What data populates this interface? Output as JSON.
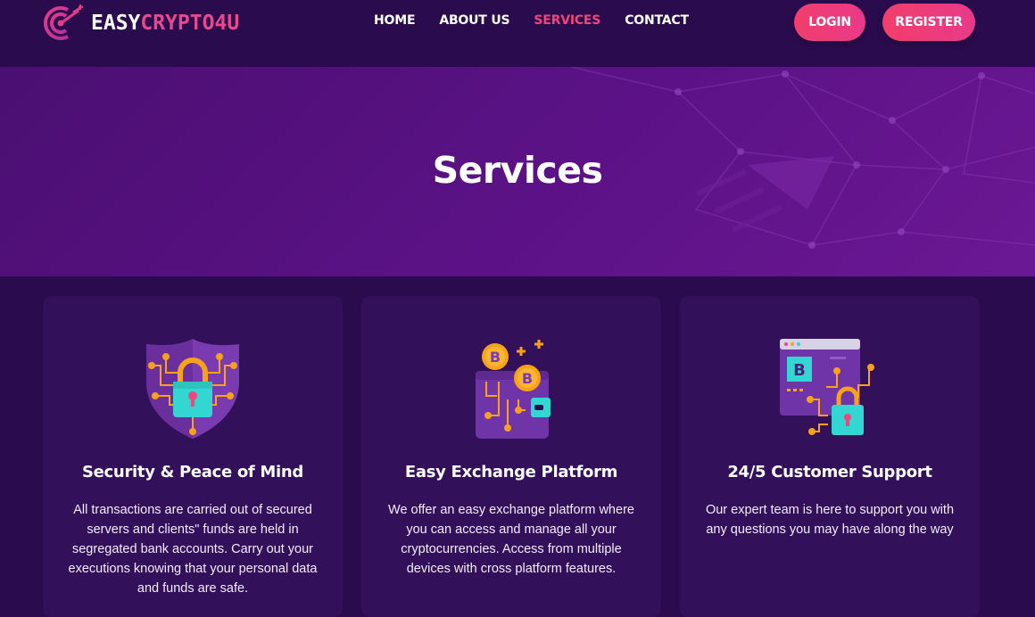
{
  "logo": {
    "text_white": "EASY",
    "text_pink": "CRYPTO4U"
  },
  "nav": {
    "items": [
      {
        "label": "HOME"
      },
      {
        "label": "ABOUT US"
      },
      {
        "label": "SERVICES"
      },
      {
        "label": "CONTACT"
      }
    ],
    "active": "SERVICES"
  },
  "auth": {
    "login_label": "LOGIN",
    "register_label": "REGISTER"
  },
  "hero": {
    "title": "Services"
  },
  "services": [
    {
      "icon": "shield-lock-icon",
      "title": "Security & Peace of Mind",
      "text": "All transactions are carried out of secured servers and clients\" funds are held in segregated bank accounts. Carry out your executions knowing that your personal data and funds are safe."
    },
    {
      "icon": "bitcoin-wallet-icon",
      "title": "Easy Exchange Platform",
      "text": "We offer an easy exchange platform where you can access and manage all your cryptocurrencies. Access from multiple devices with cross platform features."
    },
    {
      "icon": "browser-lock-icon",
      "title": "24/5 Customer Support",
      "text": "Our expert team is here to support you with any questions you may have along the way"
    }
  ],
  "colors": {
    "background": "#2a0c4e",
    "hero": "#5c1286",
    "accent": "#f0457d",
    "card": "#33105a"
  }
}
